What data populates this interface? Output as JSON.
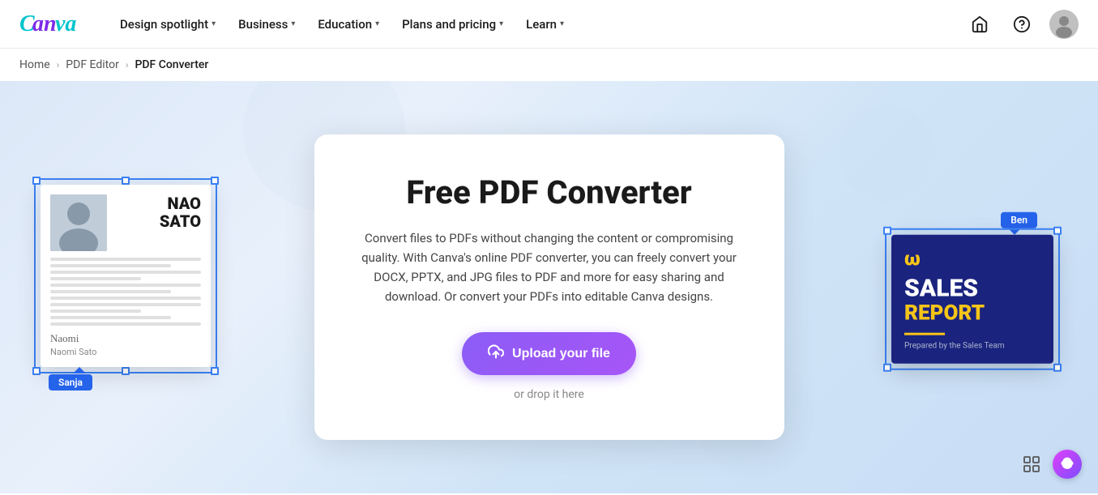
{
  "brand": {
    "logo_text": "Canva",
    "logo_color": "#00c4cc"
  },
  "nav": {
    "items": [
      {
        "id": "design-spotlight",
        "label": "Design spotlight",
        "has_dropdown": true
      },
      {
        "id": "business",
        "label": "Business",
        "has_dropdown": true
      },
      {
        "id": "education",
        "label": "Education",
        "has_dropdown": true
      },
      {
        "id": "plans-pricing",
        "label": "Plans and pricing",
        "has_dropdown": true
      },
      {
        "id": "learn",
        "label": "Learn",
        "has_dropdown": true
      }
    ],
    "icons": {
      "home": "⌂",
      "help": "?",
      "avatar_alt": "User avatar"
    }
  },
  "breadcrumb": {
    "items": [
      {
        "label": "Home",
        "href": "#"
      },
      {
        "label": "PDF Editor",
        "href": "#"
      },
      {
        "label": "PDF Converter",
        "current": true
      }
    ],
    "separator": "›"
  },
  "hero": {
    "title": "Free PDF Converter",
    "description": "Convert files to PDFs without changing the content or compromising quality. With Canva's online PDF converter, you can freely convert your DOCX, PPTX, and JPG files to PDF and more for easy sharing and download. Or convert your PDFs into editable Canva designs.",
    "upload_button_label": "Upload your file",
    "drop_label": "or drop it here"
  },
  "left_doc": {
    "name_line1": "NAO",
    "name_line2": "SATO",
    "collaborator": "Sanja"
  },
  "right_doc": {
    "logo": "ω",
    "title_line1": "SALES",
    "title_line2": "REPORT",
    "subtitle": "Prepared by the Sales Team",
    "collaborator": "Ben"
  },
  "bottom_icons": {
    "pages_icon": "⊞",
    "brain_icon": "⬡"
  }
}
